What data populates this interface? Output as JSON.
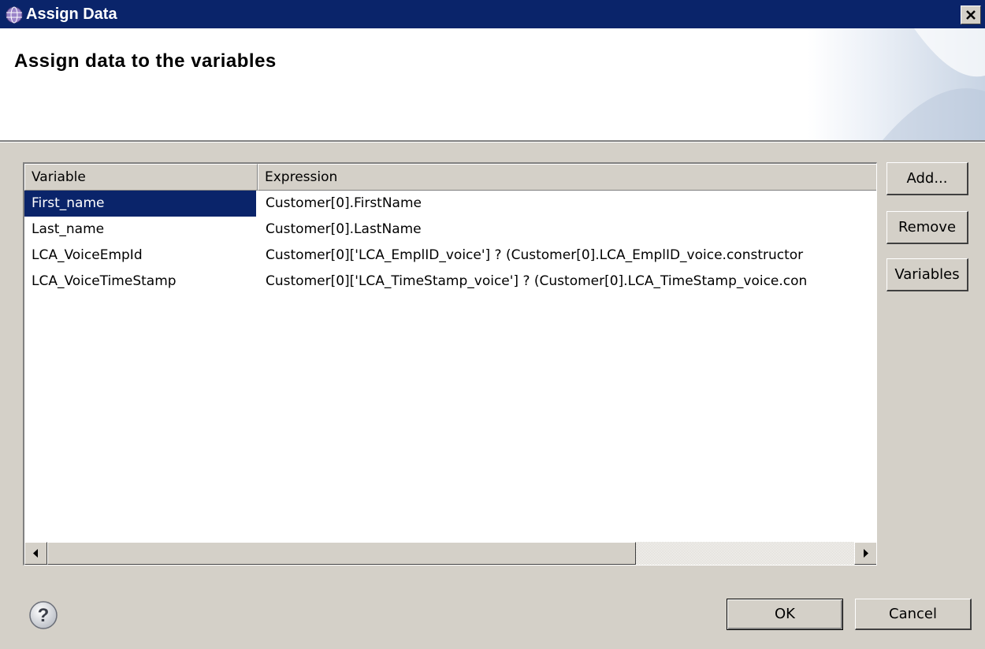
{
  "window": {
    "title": "Assign Data"
  },
  "banner": {
    "title": "Assign data to the variables"
  },
  "table": {
    "columns": [
      "Variable",
      "Expression"
    ],
    "rows": [
      {
        "variable": "First_name",
        "expression": "Customer[0].FirstName",
        "selected": true
      },
      {
        "variable": "Last_name",
        "expression": "Customer[0].LastName",
        "selected": false
      },
      {
        "variable": "LCA_VoiceEmpId",
        "expression": "Customer[0]['LCA_EmplID_voice'] ? (Customer[0].LCA_EmplID_voice.constructor",
        "selected": false
      },
      {
        "variable": "LCA_VoiceTimeStamp",
        "expression": "Customer[0]['LCA_TimeStamp_voice'] ? (Customer[0].LCA_TimeStamp_voice.con",
        "selected": false
      }
    ]
  },
  "buttons": {
    "add": "Add...",
    "remove": "Remove",
    "variables": "Variables",
    "ok": "OK",
    "cancel": "Cancel"
  },
  "icons": {
    "window": "globe-icon",
    "close": "close-icon",
    "help": "help-icon",
    "scroll_left": "arrow-left-icon",
    "scroll_right": "arrow-right-icon"
  },
  "colors": {
    "titlebar": "#0a246a",
    "selection": "#0a246a",
    "face": "#d4d0c8"
  }
}
